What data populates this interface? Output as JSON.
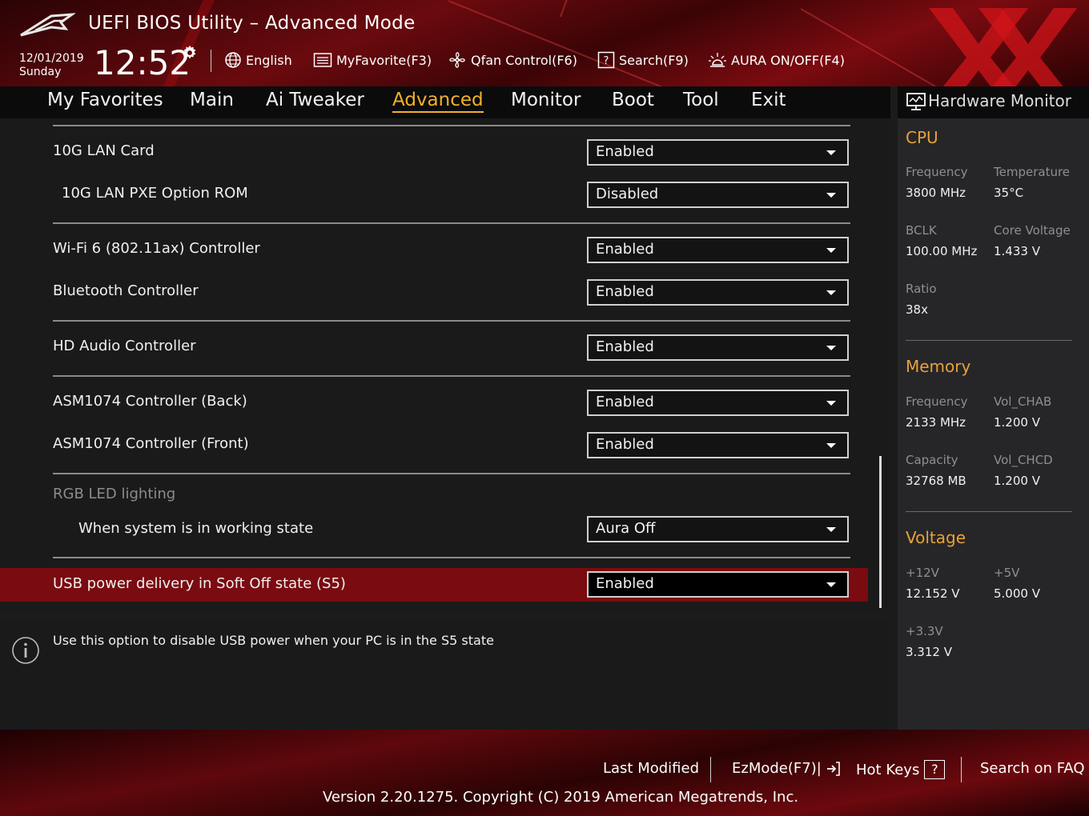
{
  "header": {
    "title": "UEFI BIOS Utility – Advanced Mode",
    "date": "12/01/2019",
    "day": "Sunday",
    "time": "12:52",
    "language": "English",
    "favorites_button": "MyFavorite(F3)",
    "qfan_button": "Qfan Control(F6)",
    "search_button": "Search(F9)",
    "aura_button": "AURA ON/OFF(F4)"
  },
  "tabs": [
    {
      "label": "My Favorites",
      "active": false
    },
    {
      "label": "Main",
      "active": false
    },
    {
      "label": "Ai Tweaker",
      "active": false
    },
    {
      "label": "Advanced",
      "active": true
    },
    {
      "label": "Monitor",
      "active": false
    },
    {
      "label": "Boot",
      "active": false
    },
    {
      "label": "Tool",
      "active": false
    },
    {
      "label": "Exit",
      "active": false
    }
  ],
  "settings": [
    {
      "label": "10G LAN Card",
      "value": "Enabled"
    },
    {
      "label": "10G LAN PXE Option ROM",
      "value": "Disabled"
    },
    {
      "label": "Wi-Fi 6 (802.11ax) Controller",
      "value": "Enabled"
    },
    {
      "label": "Bluetooth Controller",
      "value": "Enabled"
    },
    {
      "label": "HD Audio Controller",
      "value": "Enabled"
    },
    {
      "label": "ASM1074 Controller (Back)",
      "value": "Enabled"
    },
    {
      "label": "ASM1074 Controller (Front)",
      "value": "Enabled"
    },
    {
      "label": "RGB LED lighting"
    },
    {
      "label": "When system is in working state",
      "value": "Aura Off"
    },
    {
      "label": "USB power delivery in Soft Off state (S5)",
      "value": "Enabled",
      "selected": true
    }
  ],
  "help_text": "Use this option to disable USB power when your PC is in the S5 state",
  "hardware_monitor": {
    "title": "Hardware Monitor",
    "cpu": {
      "heading": "CPU",
      "frequency_label": "Frequency",
      "frequency": "3800 MHz",
      "temperature_label": "Temperature",
      "temperature": "35°C",
      "bclk_label": "BCLK",
      "bclk": "100.00 MHz",
      "core_voltage_label": "Core Voltage",
      "core_voltage": "1.433 V",
      "ratio_label": "Ratio",
      "ratio": "38x"
    },
    "memory": {
      "heading": "Memory",
      "frequency_label": "Frequency",
      "frequency": "2133 MHz",
      "vol_chab_label": "Vol_CHAB",
      "vol_chab": "1.200 V",
      "capacity_label": "Capacity",
      "capacity": "32768 MB",
      "vol_chcd_label": "Vol_CHCD",
      "vol_chcd": "1.200 V"
    },
    "voltage": {
      "heading": "Voltage",
      "v12_label": "+12V",
      "v12": "12.152 V",
      "v5_label": "+5V",
      "v5": "5.000 V",
      "v33_label": "+3.3V",
      "v33": "3.312 V"
    }
  },
  "footer": {
    "last_modified": "Last Modified",
    "ezmode": "EzMode(F7)|",
    "hot_keys": "Hot Keys",
    "hot_keys_key": "?",
    "search_faq": "Search on FAQ",
    "version": "Version 2.20.1275. Copyright (C) 2019 American Megatrends, Inc."
  },
  "colors": {
    "accent": "#f1b12b",
    "section_heading": "#e8a13a",
    "highlight_row": "#7a0b10",
    "header_red": "#6a0a0e"
  },
  "icons": [
    "rog-logo-icon",
    "gear-icon",
    "globe-icon",
    "favorites-icon",
    "fan-icon",
    "search-help-icon",
    "aura-icon",
    "monitor-icon",
    "info-icon",
    "exit-arrow-icon",
    "watermark-x-icon"
  ]
}
